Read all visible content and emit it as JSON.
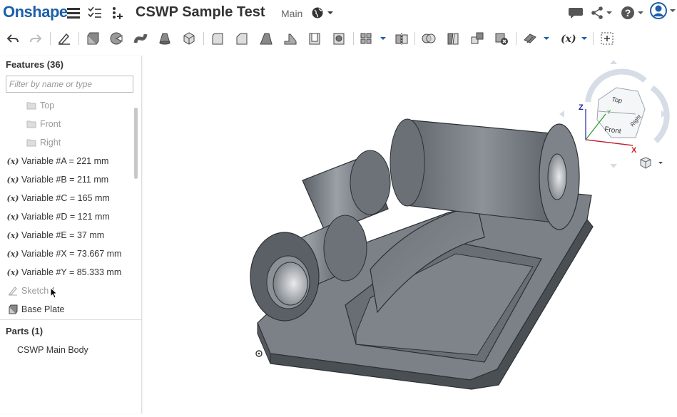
{
  "app": {
    "logo": "Onshape",
    "doc_title": "CSWP Sample Test",
    "workspace": "Main"
  },
  "colors": {
    "brand": "#1d5fa8",
    "model": "#6f757b",
    "toolbar_icon": "#444444"
  },
  "header_icons": [
    "menu-icon",
    "feature-list-icon",
    "insert-icon",
    "globe-icon",
    "comment-icon",
    "share-icon",
    "help-icon",
    "user-icon"
  ],
  "toolbar_icons": [
    "undo-icon",
    "redo-icon",
    "sketch-icon",
    "extrude-icon",
    "revolve-icon",
    "sweep-icon",
    "loft-icon",
    "thicken-icon",
    "fillet-icon",
    "chamfer-icon",
    "draft-icon",
    "rib-icon",
    "shell-icon",
    "hole-icon",
    "pattern-icon",
    "mirror-icon",
    "boolean-icon",
    "split-icon",
    "transform-icon",
    "delete-part-icon",
    "plane-icon",
    "variable-icon",
    "configuration-icon"
  ],
  "features": {
    "title": "Features (36)",
    "filter_placeholder": "Filter by name or type",
    "items": [
      {
        "label": "Top",
        "type": "plane"
      },
      {
        "label": "Front",
        "type": "plane"
      },
      {
        "label": "Right",
        "type": "plane"
      },
      {
        "label": "Variable #A = 221 mm",
        "type": "variable"
      },
      {
        "label": "Variable #B = 211 mm",
        "type": "variable"
      },
      {
        "label": "Variable #C = 165 mm",
        "type": "variable"
      },
      {
        "label": "Variable #D = 121 mm",
        "type": "variable"
      },
      {
        "label": "Variable #E = 37 mm",
        "type": "variable"
      },
      {
        "label": "Variable #X = 73.667 mm",
        "type": "variable"
      },
      {
        "label": "Variable #Y = 85.333 mm",
        "type": "variable"
      },
      {
        "label": "Sketch 1",
        "type": "sketch"
      },
      {
        "label": "Base Plate",
        "type": "extrude"
      }
    ],
    "variable_icon_text": "(x)"
  },
  "parts": {
    "title": "Parts (1)",
    "items": [
      "CSWP Main Body"
    ]
  },
  "view_cube": {
    "top": "Top",
    "front": "Front",
    "right": "Right",
    "axis_x": "X",
    "axis_y": "Y",
    "axis_z": "Z"
  }
}
